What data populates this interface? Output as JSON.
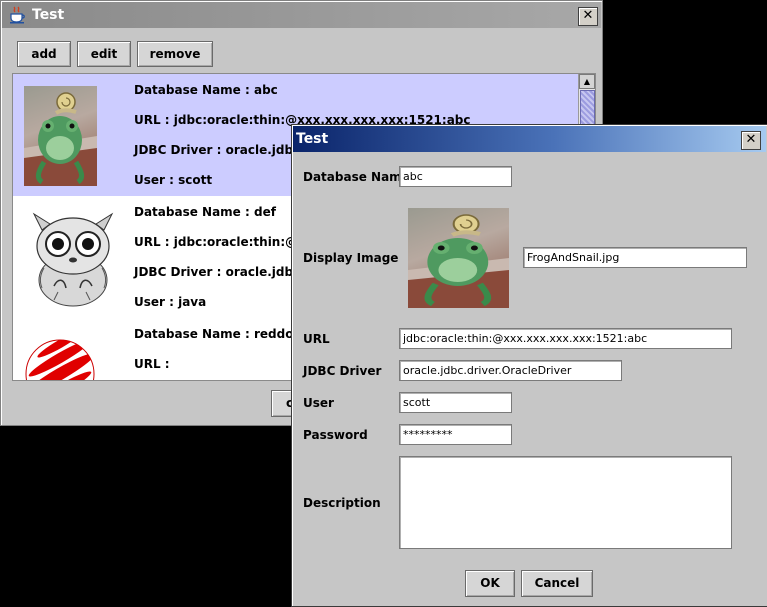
{
  "main_window": {
    "title": "Test",
    "close_glyph": "✕",
    "toolbar": {
      "add_label": "add",
      "edit_label": "edit",
      "remove_label": "remove"
    },
    "bottom_button_fragment": "c",
    "records": [
      {
        "image": "frog-with-snail-image",
        "database_name": "Database Name : abc",
        "url": "URL : jdbc:oracle:thin:@xxx.xxx.xxx.xxx:1521:abc",
        "driver": "JDBC Driver : oracle.jdbc.dri",
        "user": "User : scott",
        "selected": true
      },
      {
        "image": "tarsier-sketch-image",
        "database_name": "Database Name : def",
        "url": "URL : jdbc:oracle:thin:@xxx.",
        "driver": "JDBC Driver : oracle.jdbc.dr",
        "user": "User : java",
        "selected": false
      },
      {
        "image": "red-dot-ball-image",
        "database_name": "Database Name : reddot",
        "url": "URL :",
        "driver": "",
        "user": "",
        "selected": false
      }
    ]
  },
  "dialog": {
    "title": "Test",
    "close_glyph": "✕",
    "labels": {
      "database_name": "Database Name",
      "display_image": "Display Image",
      "url": "URL",
      "jdbc_driver": "JDBC Driver",
      "user": "User",
      "password": "Password",
      "description": "Description"
    },
    "values": {
      "database_name": "abc",
      "image_file": "FrogAndSnail.jpg",
      "url": "jdbc:oracle:thin:@xxx.xxx.xxx.xxx:1521:abc",
      "jdbc_driver": "oracle.jdbc.driver.OracleDriver",
      "user": "scott",
      "password": "*********",
      "description": ""
    },
    "ok_label": "OK",
    "cancel_label": "Cancel"
  },
  "colors": {
    "selection": "#ccccff",
    "active_title_start": "#0a246a",
    "active_title_end": "#a6caf0",
    "inactive_title": "#808080",
    "panel": "#c6c6c6"
  }
}
